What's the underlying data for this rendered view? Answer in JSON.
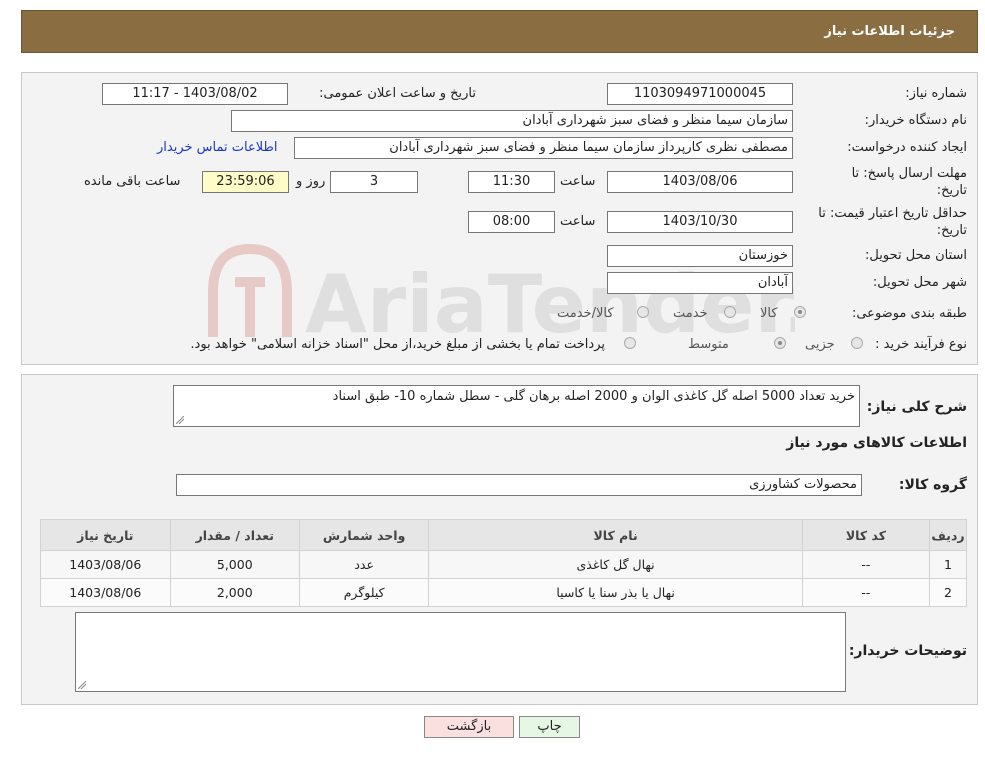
{
  "header": {
    "title": "جزئیات اطلاعات نیاز"
  },
  "details": {
    "need_number_label": "شماره نیاز:",
    "need_number": "1103094971000045",
    "announce_label": "تاریخ و ساعت اعلان عمومی:",
    "announce_value": "1403/08/02 - 11:17",
    "buyer_org_label": "نام دستگاه خریدار:",
    "buyer_org": "سازمان سیما منظر و فضای سبز شهرداری آبادان",
    "requester_label": "ایجاد کننده درخواست:",
    "requester": "مصطفی نظری کارپرداز سازمان سیما منظر و فضای سبز شهرداری آبادان",
    "contact_link": "اطلاعات تماس خریدار",
    "reply_deadline_label_1": "مهلت ارسال پاسخ: تا",
    "reply_deadline_label_2": "تاریخ:",
    "reply_date": "1403/08/06",
    "hour_label": "ساعت",
    "reply_time": "11:30",
    "days_value": "3",
    "days_label": "روز و",
    "remaining_time": "23:59:06",
    "remaining_label": "ساعت باقی مانده",
    "price_validity_label_1": "حداقل تاریخ اعتبار قیمت: تا",
    "price_validity_label_2": "تاریخ:",
    "price_date": "1403/10/30",
    "price_time": "08:00",
    "province_label": "استان محل تحویل:",
    "province": "خوزستان",
    "city_label": "شهر محل تحویل:",
    "city": "آبادان",
    "category_label": "طبقه بندی موضوعی:",
    "category_options": [
      "کالا",
      "خدمت",
      "کالا/خدمت"
    ],
    "process_label": "نوع فرآیند خرید :",
    "process_options": [
      "جزیی",
      "متوسط"
    ],
    "process_note": "پرداخت تمام یا بخشی از مبلغ خرید،از محل \"اسناد خزانه اسلامی\" خواهد بود."
  },
  "summary": {
    "description_label": "شرح کلی نیاز:",
    "description": "خرید تعداد 5000 اصله گل کاغذی الوان و 2000 اصله برهان گلی - سطل شماره 10- طبق اسناد",
    "goods_info_title": "اطلاعات کالاهای مورد نیاز",
    "goods_group_label": "گروه کالا:",
    "goods_group": "محصولات کشاورزی"
  },
  "table": {
    "headers": [
      "ردیف",
      "کد کالا",
      "نام کالا",
      "واحد شمارش",
      "تعداد / مقدار",
      "تاریخ نیاز"
    ],
    "rows": [
      [
        "1",
        "--",
        "نهال گل کاغذی",
        "عدد",
        "5,000",
        "1403/08/06"
      ],
      [
        "2",
        "--",
        "نهال یا بذر سنا یا کاسیا",
        "کیلوگرم",
        "2,000",
        "1403/08/06"
      ]
    ]
  },
  "buyer_notes": {
    "label": "توضیحات خریدار:",
    "value": ""
  },
  "buttons": {
    "print": "چاپ",
    "back": "بازگشت"
  },
  "watermark": {
    "text": "AriaTender.neT"
  },
  "colors": {
    "header_bg": "#8b6d42",
    "link": "#1a36c9",
    "print_btn": "#e6f7e6",
    "back_btn": "#fbe0e0"
  }
}
